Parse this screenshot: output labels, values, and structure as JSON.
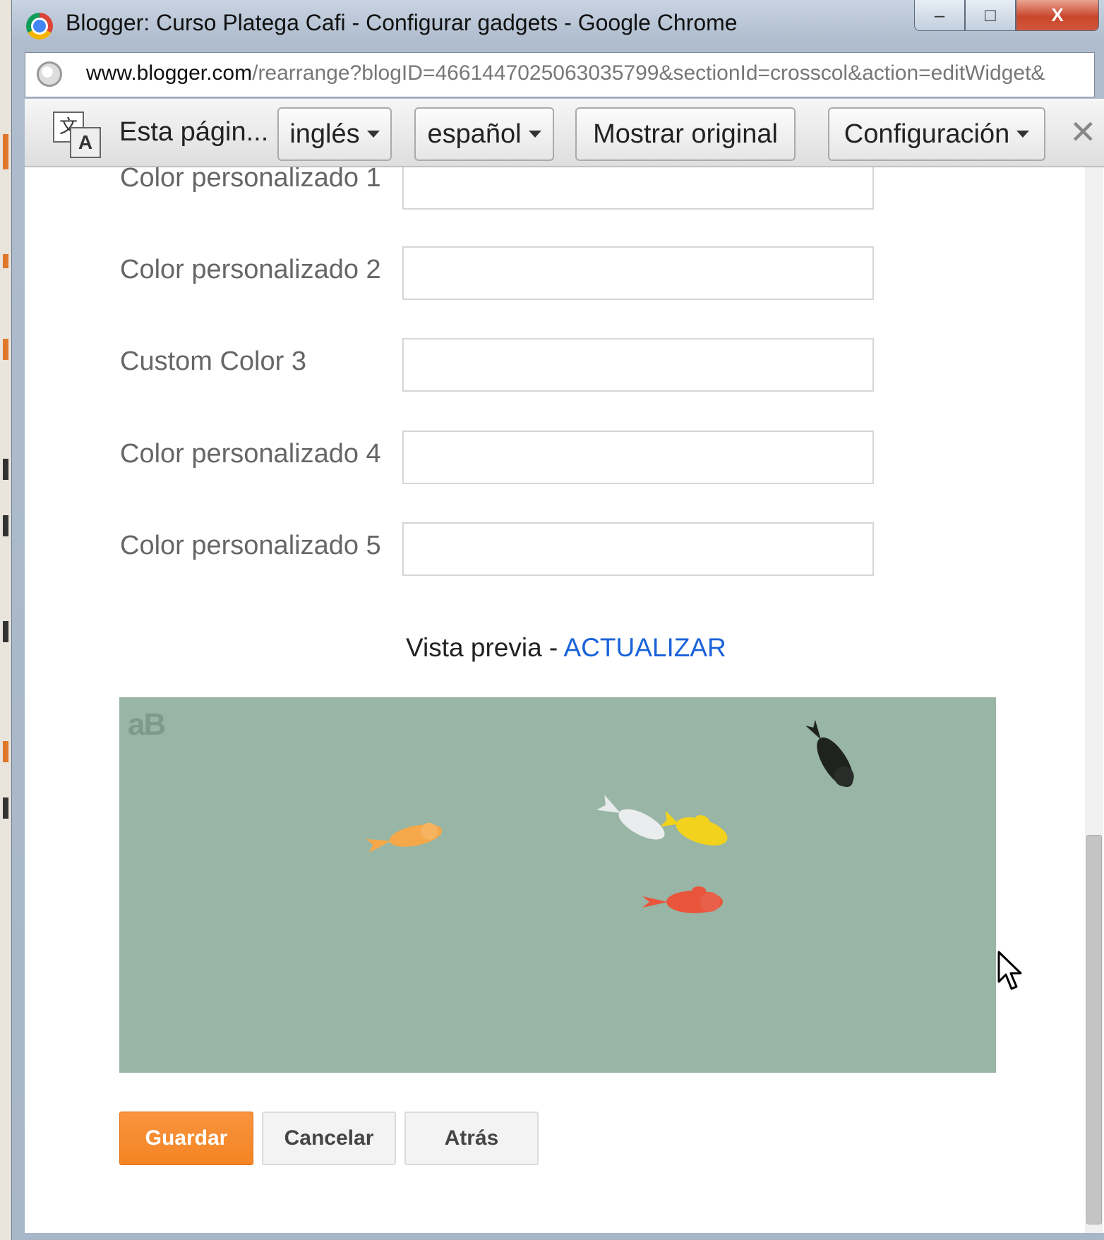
{
  "window": {
    "title": "Blogger: Curso Platega Cafi - Configurar gadgets - Google Chrome",
    "controls": {
      "minimize": "–",
      "maximize": "□",
      "close": "X"
    }
  },
  "address": {
    "host": "www.blogger.com",
    "path": "/rearrange?blogID=4661447025063035799&sectionId=crosscol&action=editWidget&"
  },
  "translate_bar": {
    "icon_a": "文",
    "icon_b": "A",
    "label": "Esta págin...",
    "from_lang": "inglés",
    "to_lang": "español",
    "show_original": "Mostrar original",
    "settings": "Configuración",
    "close": "✕"
  },
  "form": {
    "fields": [
      {
        "label": "Color personalizado 1",
        "value": ""
      },
      {
        "label": "Color personalizado 2",
        "value": ""
      },
      {
        "label": "Custom Color 3",
        "value": ""
      },
      {
        "label": "Color personalizado 4",
        "value": ""
      },
      {
        "label": "Color personalizado 5",
        "value": ""
      }
    ]
  },
  "preview": {
    "label": "Vista previa - ",
    "refresh_link": "ACTUALIZAR",
    "background_color": "#98b5a5",
    "logo_text": "aB",
    "fish_colors": [
      "#f5a84a",
      "#eef0f0",
      "#f2d21c",
      "#e8553b",
      "#1f2320"
    ]
  },
  "actions": {
    "save": "Guardar",
    "cancel": "Cancelar",
    "back": "Atrás"
  },
  "colors": {
    "accent_orange": "#f48424",
    "link_blue": "#1a62d8"
  }
}
